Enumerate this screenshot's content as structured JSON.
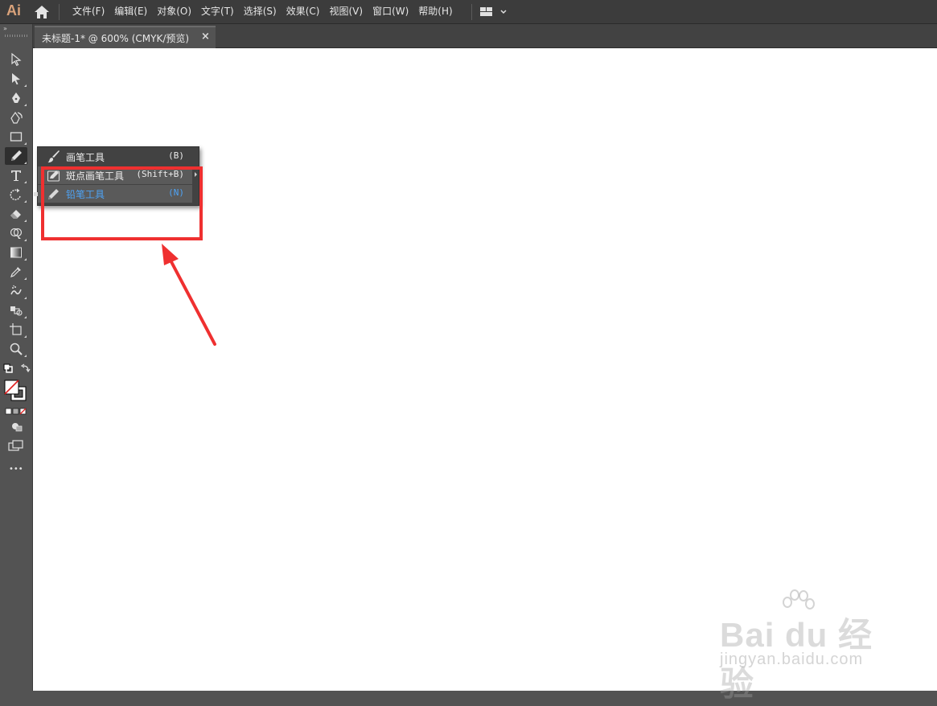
{
  "app": {
    "logo_text": "Ai"
  },
  "menu": {
    "items": [
      "文件(F)",
      "编辑(E)",
      "对象(O)",
      "文字(T)",
      "选择(S)",
      "效果(C)",
      "视图(V)",
      "窗口(W)",
      "帮助(H)"
    ]
  },
  "document": {
    "tab_title": "未标题-1* @ 600% (CMYK/预览)",
    "close_glyph": "×"
  },
  "toolbar": {
    "collapse_glyph": "»",
    "more_glyph": "•••",
    "tools": [
      "selection-tool",
      "direct-selection-tool",
      "pen-tool",
      "curvature-tool",
      "rectangle-tool",
      "paintbrush-tool",
      "type-tool",
      "rotate-tool",
      "eraser-tool",
      "shape-builder-tool",
      "gradient-tool",
      "eyedropper-tool",
      "blend-tool",
      "symbol-sprayer-tool",
      "artboard-tool",
      "zoom-tool"
    ]
  },
  "flyout": {
    "items": [
      {
        "label": "画笔工具",
        "shortcut": "(B)",
        "icon": "paintbrush-icon"
      },
      {
        "label": "斑点画笔工具",
        "shortcut": "(Shift+B)",
        "icon": "blob-brush-icon"
      },
      {
        "label": "铅笔工具",
        "shortcut": "(N)",
        "icon": "pencil-icon"
      }
    ]
  },
  "annotation": {
    "color": "#ef3030"
  },
  "watermark": {
    "brand": "Bai du 经验",
    "url": "jingyan.baidu.com"
  },
  "colors": {
    "accent_blue": "#4ea3f5",
    "ui_dark": "#3c3c3c",
    "ui_panel": "#535353"
  }
}
